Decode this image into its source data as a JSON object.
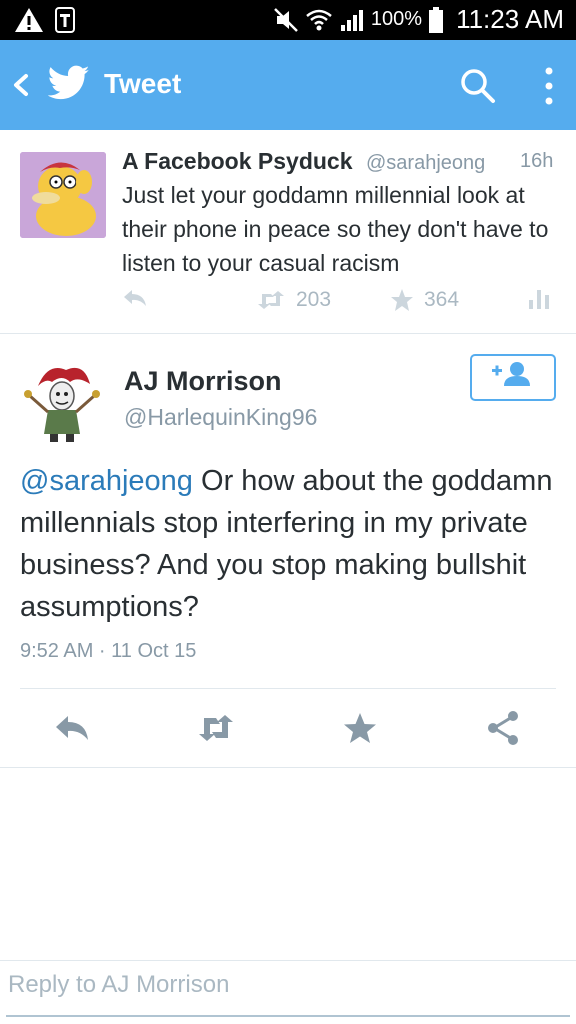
{
  "status_bar": {
    "battery": "100%",
    "time": "11:23 AM",
    "icons": [
      "warning-icon",
      "tmobile-icon",
      "mute-icon",
      "wifi-icon",
      "signal-icon",
      "battery-icon"
    ]
  },
  "app_bar": {
    "title": "Tweet",
    "icons": [
      "back-icon",
      "twitter-bird-icon",
      "search-icon",
      "overflow-menu-icon"
    ],
    "color": "#55acee"
  },
  "parent_tweet": {
    "author_name": "A Facebook Psyduck",
    "handle": "@sarahjeong",
    "age": "16h",
    "text": "Just let your goddamn millennial look at their phone in peace so they don't have to listen to your casual racism",
    "retweets": "203",
    "favorites": "364"
  },
  "main_tweet": {
    "author_name": "AJ Morrison",
    "handle": "@HarlequinKing96",
    "mention": "@sarahjeong",
    "text": " Or how about the goddamn millennials stop interfering in my private business? And you stop making bullshit assumptions?",
    "timestamp": "9:52 AM · 11 Oct 15",
    "follow_icon": "follow-user-icon",
    "action_icons": [
      "reply-icon",
      "retweet-icon",
      "favorite-icon",
      "share-icon"
    ]
  },
  "reply_box": {
    "placeholder": "Reply to AJ Morrison"
  },
  "colors": {
    "accent": "#55acee",
    "link": "#2b7bb9",
    "muted": "#8899a6",
    "icon_gray": "#8899a6"
  }
}
